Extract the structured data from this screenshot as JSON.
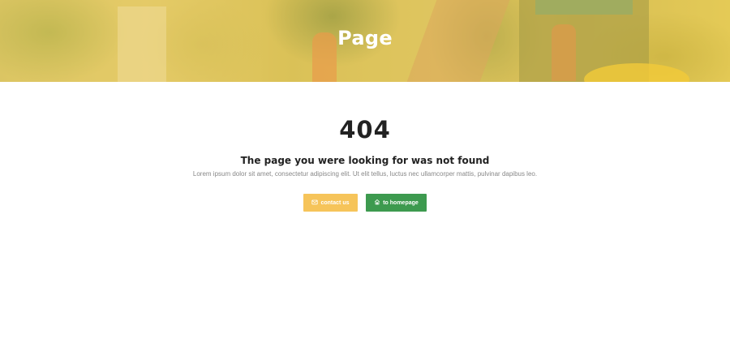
{
  "hero": {
    "title": "Page"
  },
  "error": {
    "code": "404",
    "headline": "The page you were looking for was not found",
    "description": "Lorem ipsum dolor sit amet, consectetur adipiscing elit. Ut elit tellus, luctus nec ullamcorper mattis, pulvinar dapibus leo."
  },
  "buttons": {
    "contact": {
      "label": "contact us",
      "icon": "envelope-icon",
      "color": "#f6c45a"
    },
    "home": {
      "label": "to homepage",
      "icon": "home-icon",
      "color": "#3d9a4f"
    }
  },
  "colors": {
    "hero_overlay": "#f5cd50",
    "text_dark": "#222222",
    "text_muted": "#888888"
  }
}
